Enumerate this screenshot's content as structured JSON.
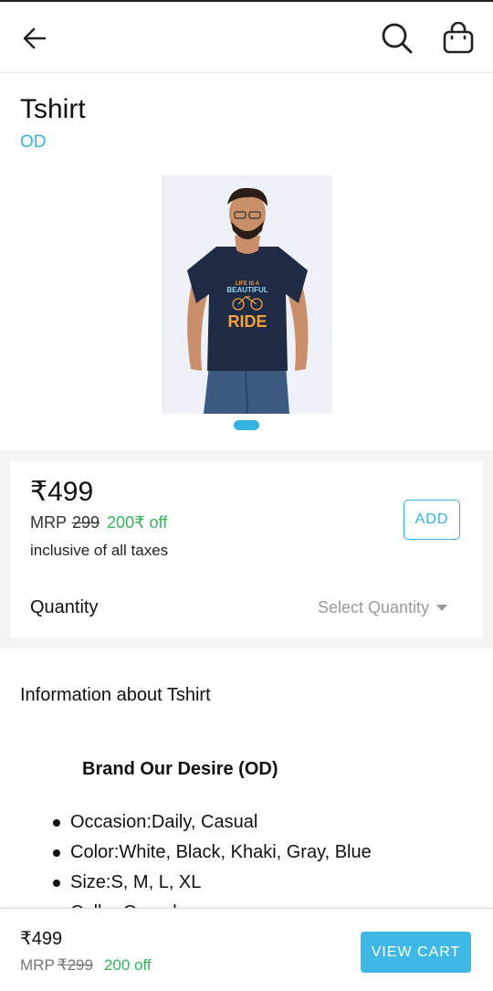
{
  "header": {
    "back_icon": "arrow-left-icon",
    "search_icon": "search-icon",
    "cart_icon": "shopping-bag-icon"
  },
  "product": {
    "title": "Tshirt",
    "brand": "OD",
    "image": {
      "graphic_text_line1": "LIFE IS A",
      "graphic_text_line2": "BEAUTIFUL",
      "graphic_text_line3": "RIDE"
    },
    "carousel_pages": 1,
    "carousel_active": 1
  },
  "pricing": {
    "price": "₹499",
    "mrp_label": "MRP",
    "mrp_value": "299",
    "discount": "200₹ off",
    "tax_note": "inclusive of all taxes",
    "add_label": "ADD",
    "quantity_label": "Quantity",
    "quantity_placeholder": "Select Quantity"
  },
  "info": {
    "heading": "Information about Tshirt",
    "brand_line": "Brand Our Desire (OD)",
    "bullets": [
      "Occasion:Daily, Casual",
      "Color:White, Black, Khaki, Gray, Blue",
      "Size:S, M, L, XL",
      "Collar:O-neck"
    ]
  },
  "bottom_bar": {
    "price": "₹499",
    "mrp_label": "MRP",
    "mrp_value": "₹299",
    "discount": "200 off",
    "view_cart_label": "VIEW CART"
  },
  "colors": {
    "accent": "#35b3e0",
    "discount_green": "#34b35a",
    "button_blue": "#3fb8e6"
  }
}
